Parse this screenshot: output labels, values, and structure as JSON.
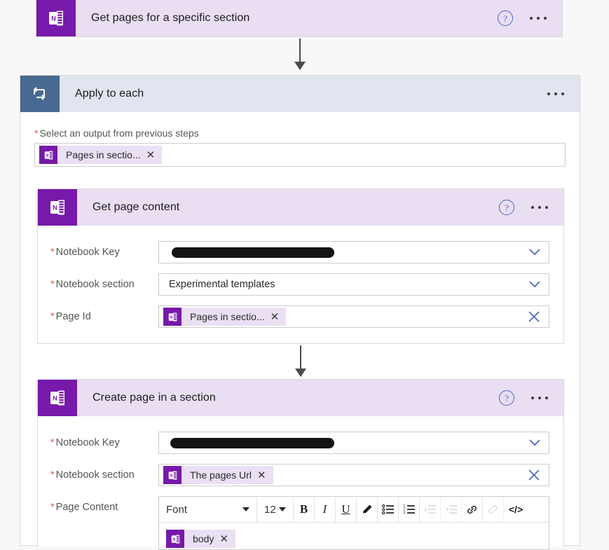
{
  "colors": {
    "onenote_purple": "#7719aa",
    "loop_blue": "#486991",
    "purple_header_bg": "#e9def2",
    "blue_header_bg": "#e1e5ef",
    "required_red": "#e8594a",
    "link_blue": "#4a66c4",
    "page_bg": "#f8f8f8"
  },
  "cards": {
    "get_pages": {
      "title": "Get pages for a specific section",
      "icon": "onenote-icon",
      "help_label": "?",
      "menu_label": "…"
    },
    "apply_to_each": {
      "title": "Apply to each",
      "icon": "loop-icon",
      "menu_label": "…",
      "select_output": {
        "label": "Select an output from previous steps",
        "required": true,
        "token": {
          "text": "Pages in sectio...",
          "remove_label": "✕",
          "icon": "onenote-icon"
        }
      }
    },
    "get_page_content": {
      "title": "Get page content",
      "icon": "onenote-icon",
      "help_label": "?",
      "menu_label": "…",
      "fields": [
        {
          "label": "Notebook Key",
          "required": true,
          "type": "dropdown",
          "value": "",
          "redacted": true,
          "control": "chevron-down-icon"
        },
        {
          "label": "Notebook section",
          "required": true,
          "type": "dropdown",
          "value": "Experimental templates",
          "redacted": false,
          "control": "chevron-down-icon"
        },
        {
          "label": "Page Id",
          "required": true,
          "type": "token",
          "token": {
            "text": "Pages in sectio...",
            "remove_label": "✕",
            "icon": "onenote-icon"
          },
          "control": "clear-x-icon"
        }
      ]
    },
    "create_page": {
      "title": "Create page in a section",
      "icon": "onenote-icon",
      "help_label": "?",
      "menu_label": "…",
      "fields": [
        {
          "label": "Notebook Key",
          "required": true,
          "type": "dropdown",
          "value": "",
          "redacted": true,
          "control": "chevron-down-icon"
        },
        {
          "label": "Notebook section",
          "required": true,
          "type": "token",
          "token": {
            "text": "The pages Url",
            "remove_label": "✕",
            "icon": "onenote-icon"
          },
          "control": "clear-x-icon"
        },
        {
          "label": "Page Content",
          "required": true,
          "type": "richtext"
        }
      ],
      "editor": {
        "font_name": "Font",
        "font_size": "12",
        "buttons": [
          {
            "name": "bold-icon",
            "label": "B",
            "disabled": false
          },
          {
            "name": "italic-icon",
            "label": "I",
            "disabled": false
          },
          {
            "name": "underline-icon",
            "label": "U",
            "disabled": false
          },
          {
            "name": "highlighter-pen-icon",
            "label": "",
            "disabled": false
          },
          {
            "name": "bulleted-list-icon",
            "label": "",
            "disabled": false
          },
          {
            "name": "numbered-list-icon",
            "label": "",
            "disabled": false
          },
          {
            "name": "indent-increase-icon",
            "label": "",
            "disabled": true
          },
          {
            "name": "indent-decrease-icon",
            "label": "",
            "disabled": true
          },
          {
            "name": "link-icon",
            "label": "",
            "disabled": false
          },
          {
            "name": "unlink-icon",
            "label": "",
            "disabled": true
          },
          {
            "name": "code-view-icon",
            "label": "</>",
            "disabled": false
          }
        ],
        "content_token": {
          "text": "body",
          "remove_label": "✕",
          "icon": "onenote-icon"
        }
      }
    }
  }
}
